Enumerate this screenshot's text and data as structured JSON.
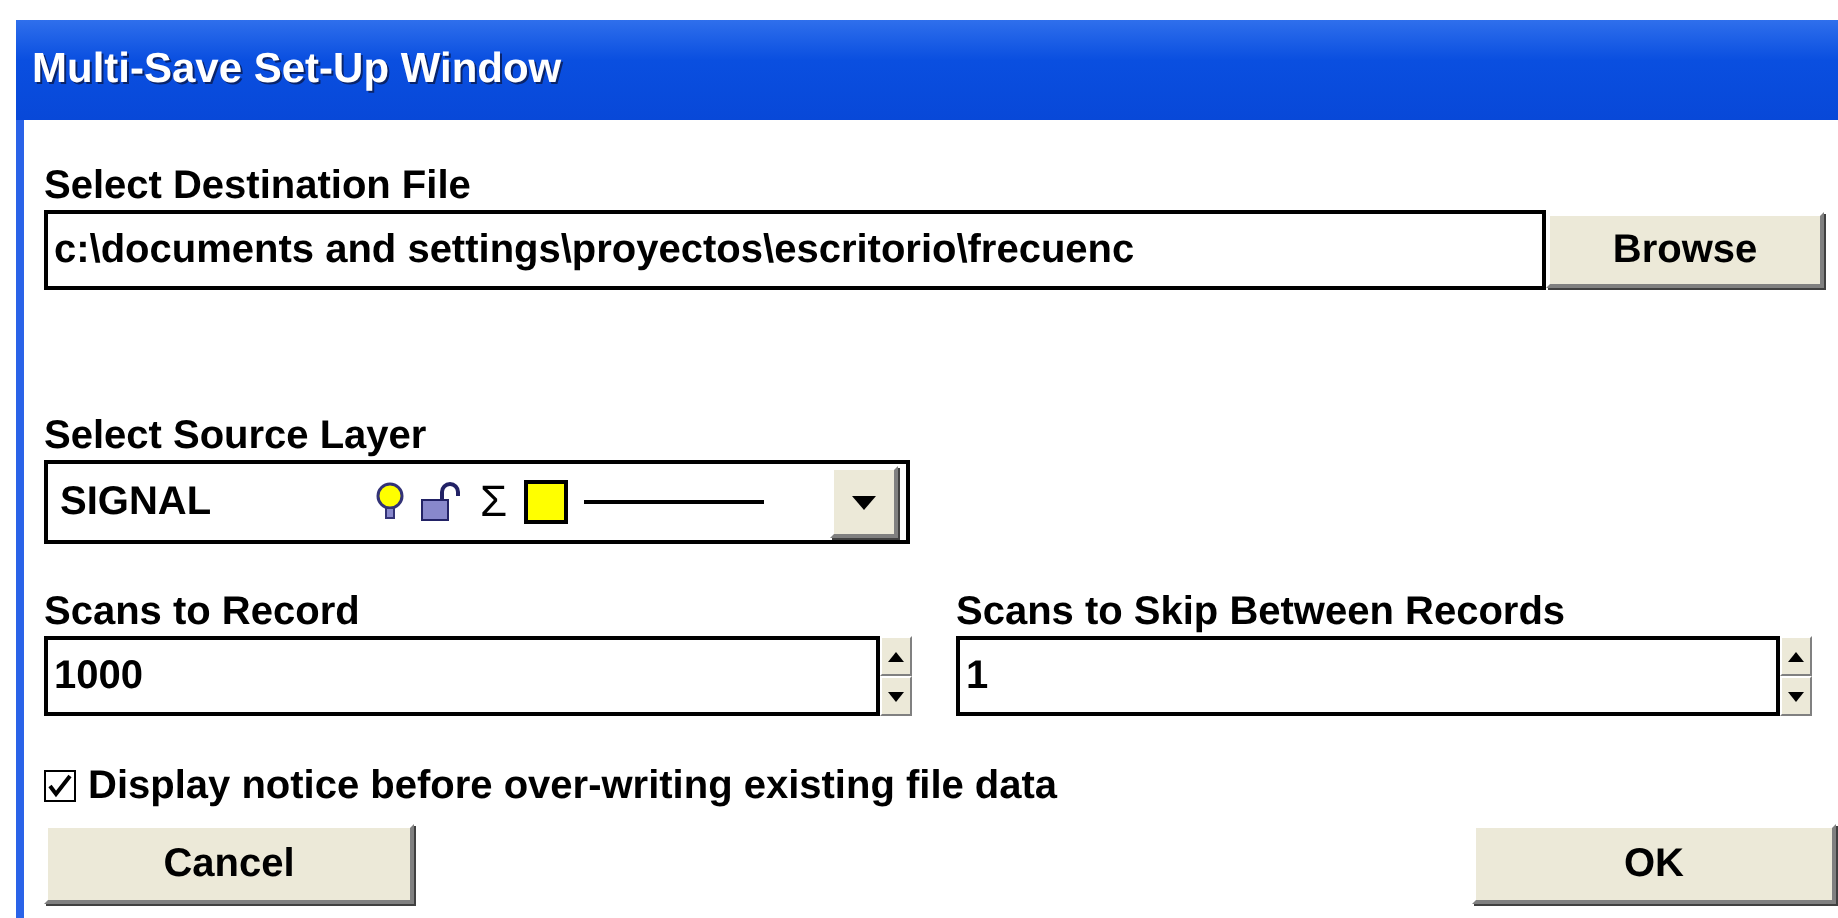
{
  "window": {
    "title": "Multi-Save Set-Up Window"
  },
  "destination": {
    "label": "Select Destination File",
    "value": "c:\\documents and settings\\proyectos\\escritorio\\frecuenc",
    "button": "Browse"
  },
  "source_layer": {
    "label": "Select Source Layer",
    "value": "SIGNAL",
    "sum_symbol": "Σ",
    "color": "#ffff00"
  },
  "scans_to_record": {
    "label": "Scans to Record",
    "value": "1000"
  },
  "scans_to_skip": {
    "label": "Scans to Skip Between Records",
    "value": "1"
  },
  "notice": {
    "label": "Display notice before over-writing existing file data",
    "checked": true
  },
  "buttons": [
    {
      "label": "Cancel",
      "kind": "cancel"
    },
    {
      "label": "OK",
      "kind": "ok"
    }
  ]
}
